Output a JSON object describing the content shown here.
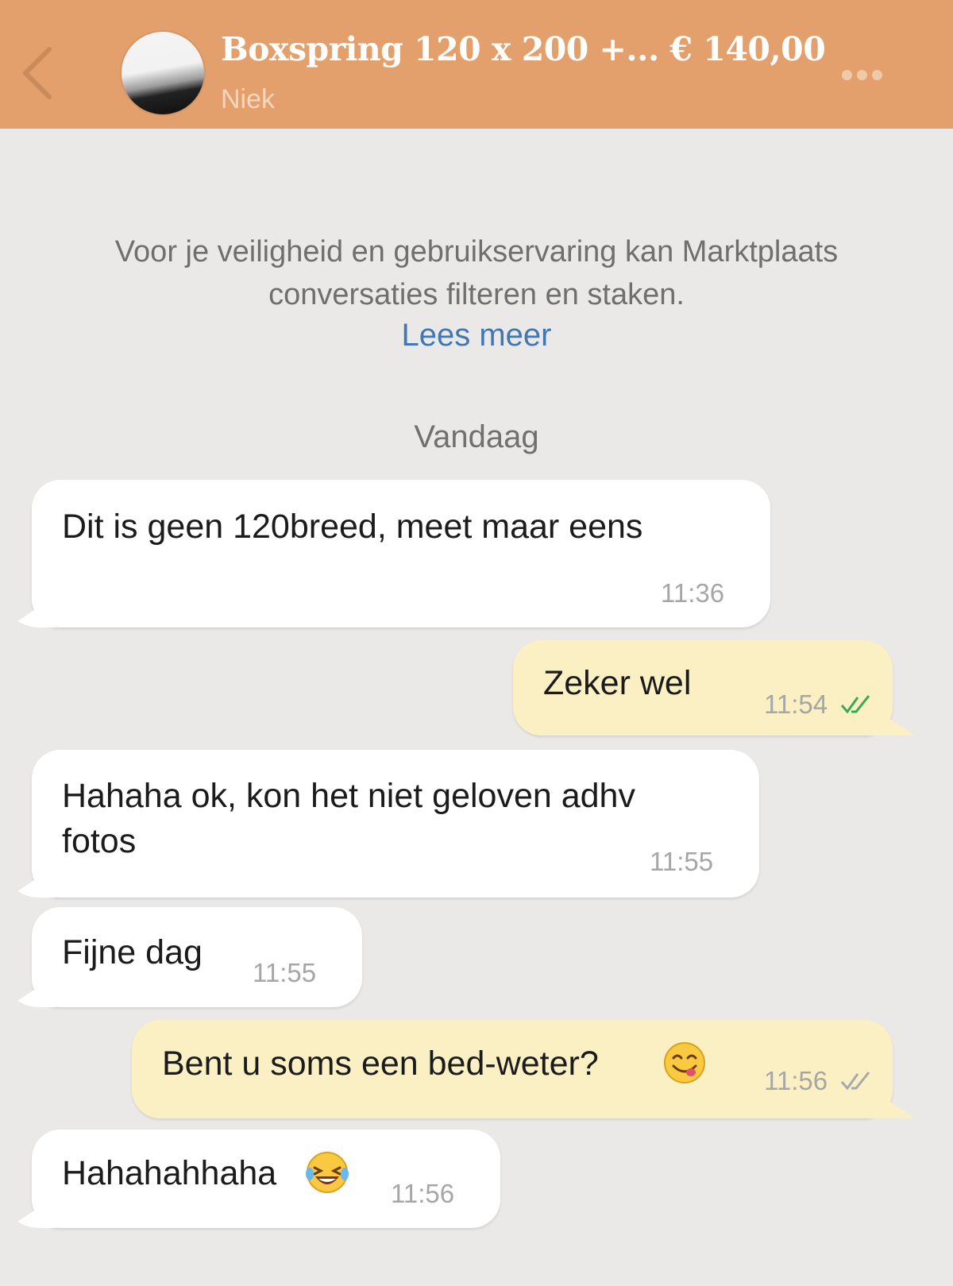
{
  "header": {
    "title": "Boxspring 120 x 200 +... € 140,00",
    "seller": "Niek",
    "back_icon": "chevron-left-icon",
    "more_icon": "more-dots-icon",
    "color": "#e3a06c"
  },
  "notice": {
    "line1": "Voor je veiligheid en gebruikservaring kan Marktplaats",
    "line2": "conversaties filteren en staken.",
    "link": "Lees meer"
  },
  "day_label": "Vandaag",
  "messages": [
    {
      "direction": "in",
      "text": "Dit is geen 120breed, meet maar eens",
      "time": "11:36"
    },
    {
      "direction": "out",
      "text": "Zeker wel",
      "time": "11:54",
      "status": "double-check-green"
    },
    {
      "direction": "in",
      "text_line1": "Hahaha ok, kon het niet geloven adhv",
      "text_line2": "fotos",
      "time": "11:55"
    },
    {
      "direction": "in",
      "text": "Fijne dag",
      "time": "11:55"
    },
    {
      "direction": "out",
      "text": "Bent u soms een bed-weter?",
      "emoji": "yum-face-emoji",
      "time": "11:56",
      "status": "double-check-gray"
    },
    {
      "direction": "in",
      "text": "Hahahahhaha",
      "emoji": "laughing-tears-emoji",
      "time": "11:56"
    }
  ]
}
